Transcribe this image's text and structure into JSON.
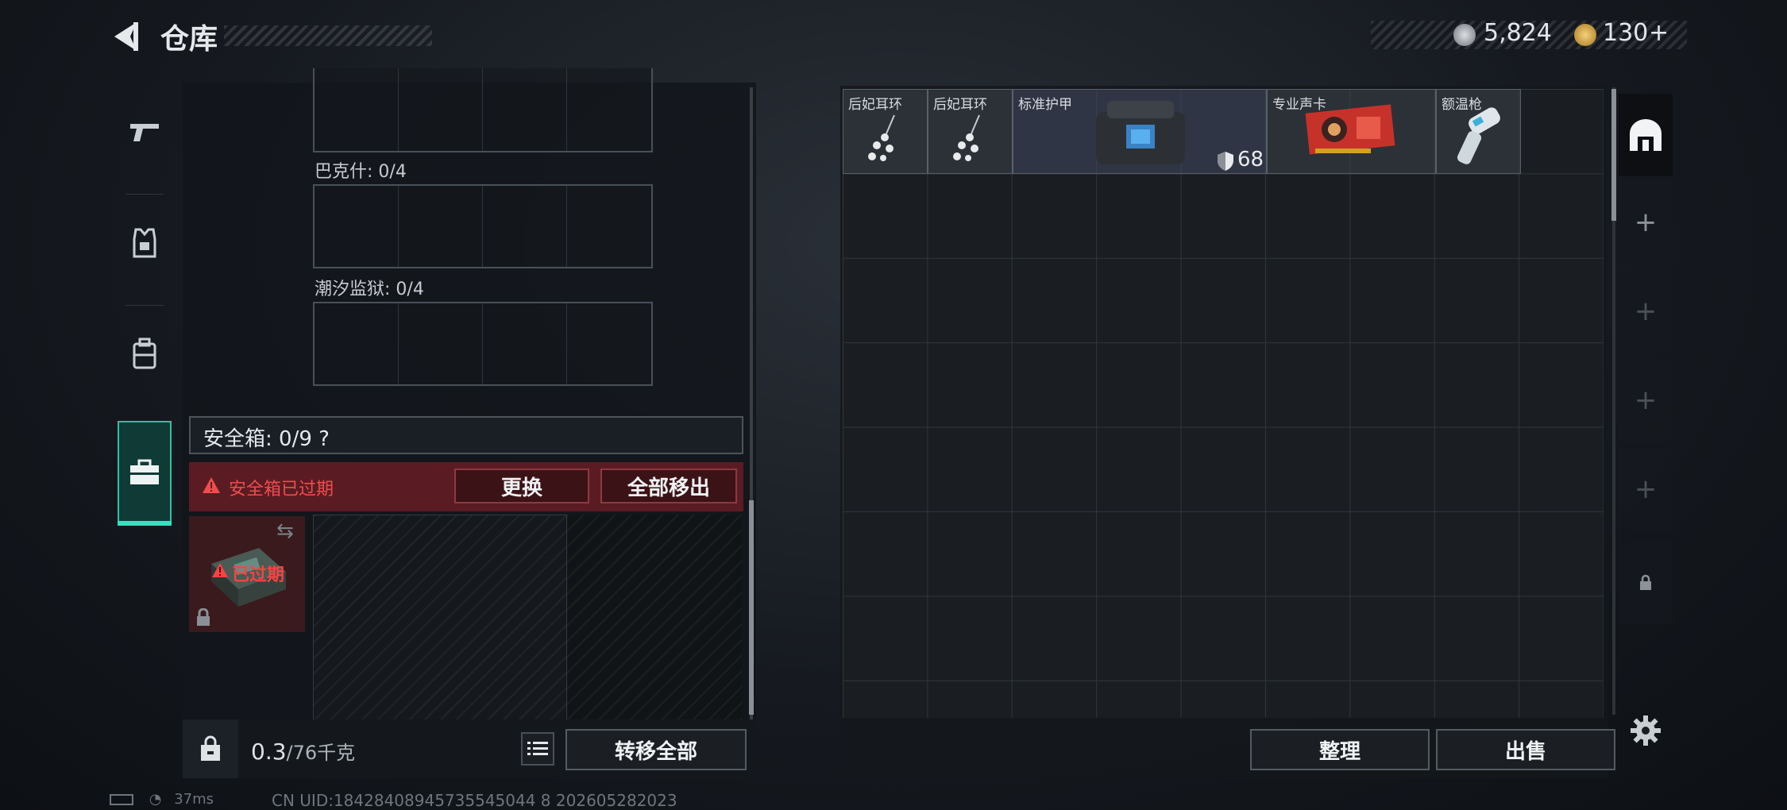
{
  "header": {
    "title": "仓库"
  },
  "currency": [
    {
      "icon": "silver-coin-icon",
      "value": "5,824"
    },
    {
      "icon": "gold-coin-icon",
      "value": "130",
      "suffix": "+"
    }
  ],
  "nav": [
    {
      "icon": "gun-icon",
      "active": false
    },
    {
      "icon": "armor-vest-icon",
      "active": false
    },
    {
      "icon": "backpack-icon",
      "active": false
    },
    {
      "icon": "briefcase-icon",
      "active": true
    }
  ],
  "containers": [
    {
      "label": "巴克什: 0/4"
    },
    {
      "label": "潮汐监狱: 0/4"
    }
  ],
  "safebox": {
    "title": "安全箱: 0/9 ?",
    "expired_notice": "安全箱已过期",
    "replace_label": "更换",
    "move_all_label": "全部移出",
    "expired_badge": "已过期"
  },
  "weight": {
    "current": "0.3",
    "max_unit": "/76千克"
  },
  "transfer_all_label": "转移全部",
  "inventory": {
    "items": [
      {
        "name": "后妃耳环",
        "icon": "earring-icon"
      },
      {
        "name": "后妃耳环",
        "icon": "earring-icon"
      },
      {
        "name": "标准护甲",
        "icon": "armor-bag-icon",
        "durability": "68"
      },
      {
        "name": "专业声卡",
        "icon": "graphics-card-icon"
      },
      {
        "name": "额温枪",
        "icon": "thermometer-gun-icon"
      }
    ],
    "organize_label": "整理",
    "sell_label": "出售"
  },
  "right_tabs": [
    "vault-icon",
    "plus-icon",
    "plus-icon",
    "plus-icon",
    "plus-icon",
    "lock-icon"
  ],
  "status": {
    "ping": "37ms",
    "uid": "CN UID:18428408945735545044 8 202605282023"
  }
}
